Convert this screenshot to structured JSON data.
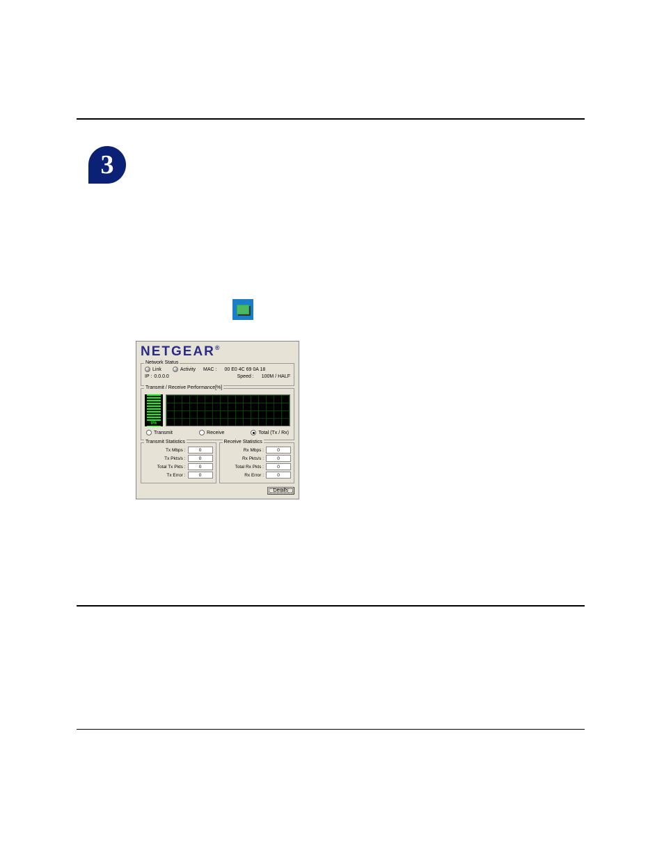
{
  "step": {
    "number": "3"
  },
  "dialog": {
    "brand": "NETGEAR",
    "brand_r": "®",
    "network_status": {
      "legend": "Network Status",
      "link_label": "Link",
      "activity_label": "Activity",
      "mac_label": "MAC :",
      "mac_value": "00 E0 4C 69 0A 18",
      "ip_label": "IP :",
      "ip_value": "0.0.0.0",
      "speed_label": "Speed :",
      "speed_value": "100M / HALF"
    },
    "perf": {
      "legend": "Transmit / Receive Performance[%]",
      "pct": "0%",
      "radios": {
        "transmit": "Transmit",
        "receive": "Receive",
        "total": "Total (Tx / Rx)"
      }
    },
    "tx": {
      "legend": "Transmit Statistics",
      "rows": [
        {
          "label": "Tx Mbps :",
          "value": "0"
        },
        {
          "label": "Tx Pkts/s :",
          "value": "0"
        },
        {
          "label": "Total Tx Pkts :",
          "value": "0"
        },
        {
          "label": "Tx Error :",
          "value": "0"
        }
      ]
    },
    "rx": {
      "legend": "Receive Statistics",
      "rows": [
        {
          "label": "Rx Mbps :",
          "value": "0"
        },
        {
          "label": "Rx Pkts/s :",
          "value": "0"
        },
        {
          "label": "Total Rx Pkts :",
          "value": "0"
        },
        {
          "label": "Rx Error :",
          "value": "0"
        }
      ]
    },
    "details_btn": "Details"
  }
}
